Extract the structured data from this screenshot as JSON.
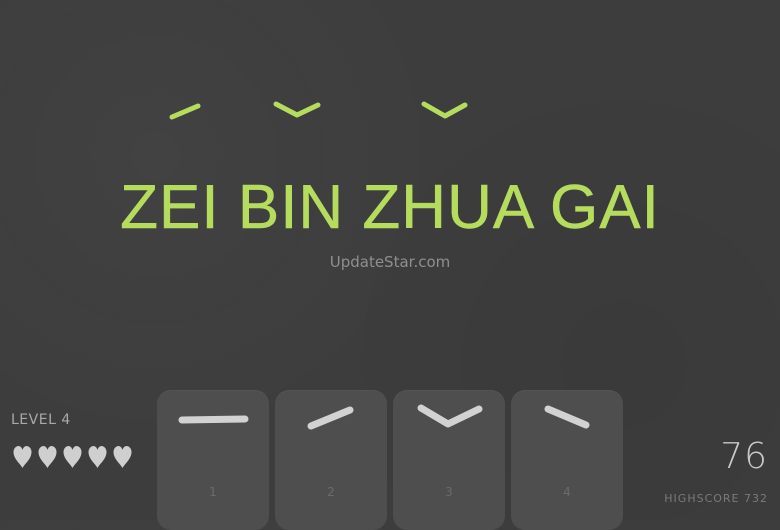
{
  "prompt": {
    "word": "ZEI BIN ZHUA GAI",
    "tone_marks": [
      "second-tone-rising",
      "third-tone-dip",
      "third-tone-dip"
    ]
  },
  "watermark": "UpdateStar.com",
  "player": {
    "level_label": "LEVEL 4",
    "lives": 5,
    "lives_icon": "heart-icon"
  },
  "cards": [
    {
      "number": "1",
      "tone": "first-tone-flat"
    },
    {
      "number": "2",
      "tone": "second-tone-rising"
    },
    {
      "number": "3",
      "tone": "third-tone-dip"
    },
    {
      "number": "4",
      "tone": "fourth-tone-falling"
    }
  ],
  "score": {
    "value": "76",
    "highscore_label": "HIGHSCORE 732"
  },
  "colors": {
    "accent": "#b6dc5e",
    "tone_mark_card": "#d2d2d2",
    "background": "#3d3d3d",
    "card": "#4e4e4e"
  }
}
